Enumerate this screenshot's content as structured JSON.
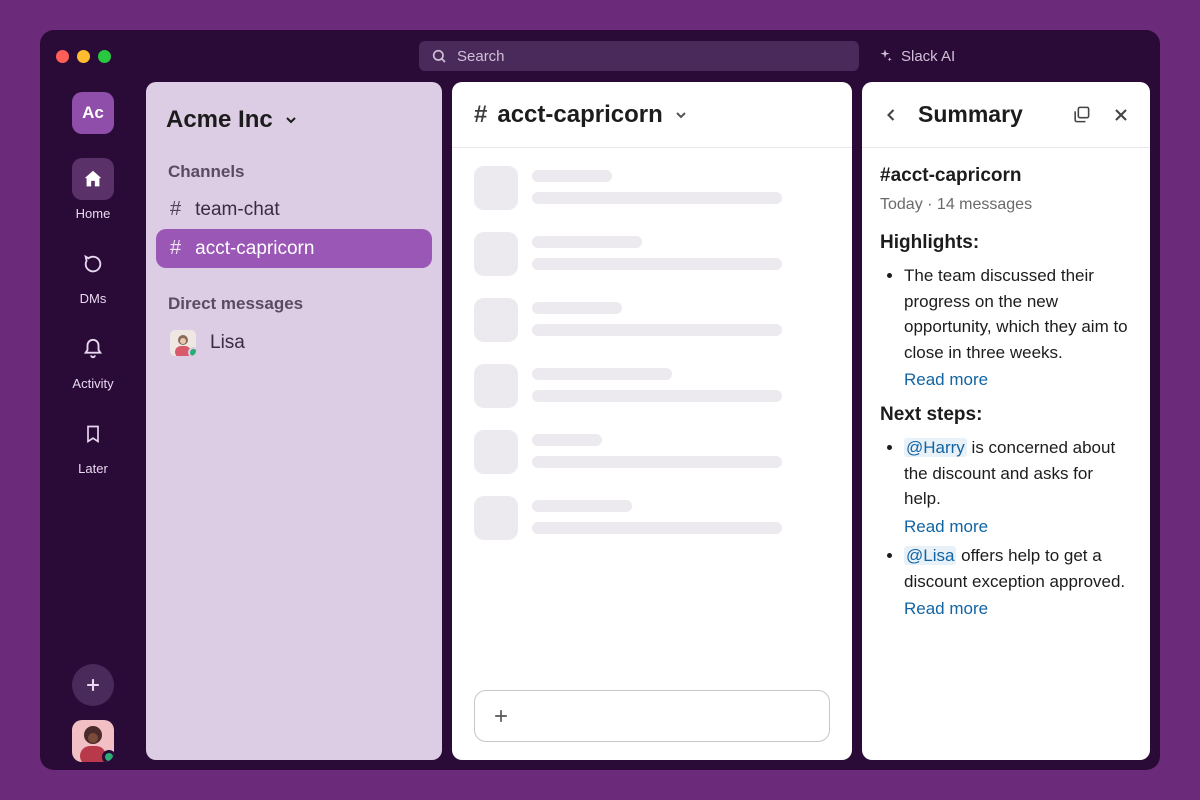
{
  "search": {
    "placeholder": "Search"
  },
  "ai_button": "Slack AI",
  "workspace": {
    "badge": "Ac",
    "name": "Acme Inc"
  },
  "rail": {
    "home": "Home",
    "dms": "DMs",
    "activity": "Activity",
    "later": "Later"
  },
  "sidebar": {
    "channels_label": "Channels",
    "channels": [
      {
        "name": "team-chat",
        "active": false
      },
      {
        "name": "acct-capricorn",
        "active": true
      }
    ],
    "dms_label": "Direct messages",
    "dms": [
      {
        "name": "Lisa"
      }
    ]
  },
  "channel": {
    "name": "acct-capricorn"
  },
  "summary": {
    "title": "Summary",
    "channel": "#acct-capricorn",
    "meta": "Today · 14 messages",
    "highlights_label": "Highlights:",
    "highlights": [
      {
        "text": "The team discussed their progress on the new opportunity, which they aim to close in three weeks.",
        "read_more": "Read more"
      }
    ],
    "nextsteps_label": "Next steps:",
    "nextsteps": [
      {
        "mention": "@Harry",
        "text": " is concerned about the discount and asks for help.",
        "read_more": "Read more"
      },
      {
        "mention": "@Lisa",
        "text": " offers help to get a discount exception approved.",
        "read_more": "Read more"
      }
    ]
  }
}
